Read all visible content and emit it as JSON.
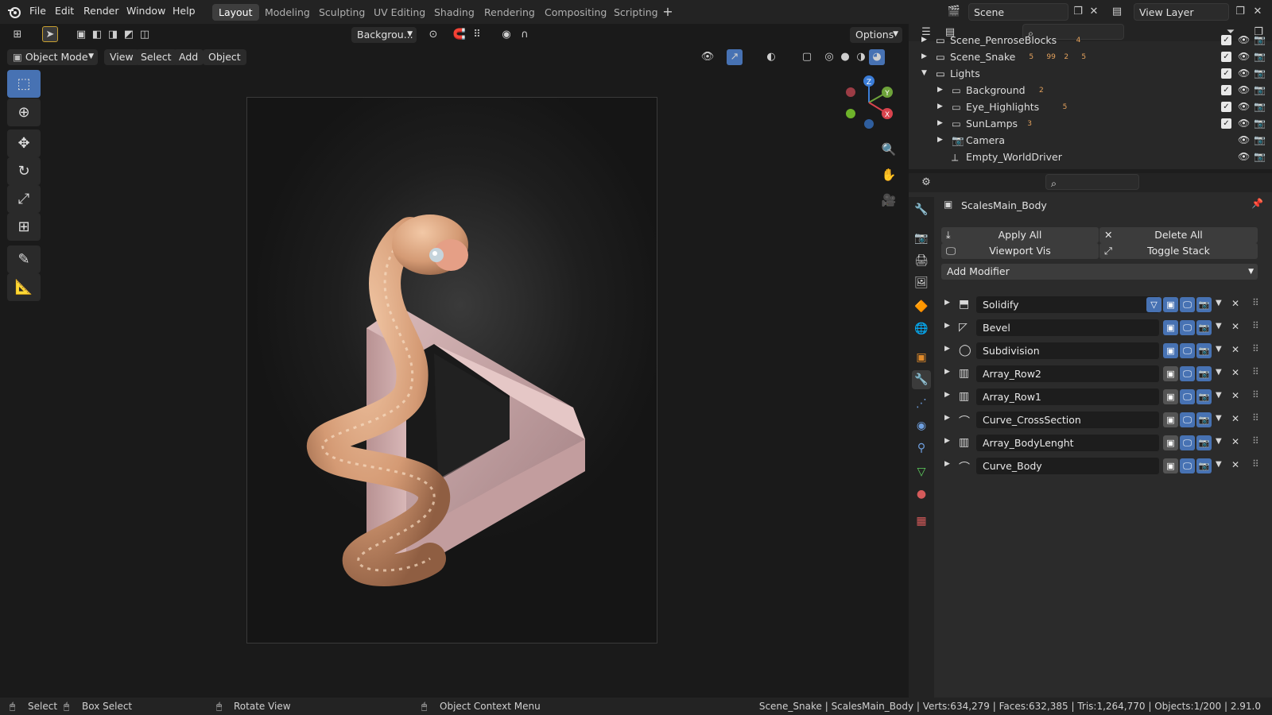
{
  "menu": [
    "File",
    "Edit",
    "Render",
    "Window",
    "Help"
  ],
  "workspaces": [
    "Layout",
    "Modeling",
    "Sculpting",
    "UV Editing",
    "Shading",
    "Rendering",
    "Compositing",
    "Scripting"
  ],
  "active_workspace": "Layout",
  "scene_field": "Scene",
  "view_layer_field": "View Layer",
  "viewport": {
    "mode": "Object Mode",
    "menus": [
      "View",
      "Select",
      "Add",
      "Object"
    ],
    "background_dropdown": "Backgrou...",
    "options_label": "Options",
    "gizmo_axes": [
      "X",
      "Y",
      "Z"
    ]
  },
  "outliner": {
    "rows": [
      {
        "label": "Scene_PenroseBlocks",
        "indent": 0,
        "count_badges": [
          "4"
        ]
      },
      {
        "label": "Scene_Snake",
        "indent": 0,
        "count_badges": [
          "5",
          "99",
          "2",
          "5"
        ]
      },
      {
        "label": "Lights",
        "indent": 0,
        "expanded": true,
        "count_badges": []
      },
      {
        "label": "Background",
        "indent": 1,
        "count_badges": [
          "2"
        ]
      },
      {
        "label": "Eye_Highlights",
        "indent": 1,
        "count_badges": [
          "5"
        ]
      },
      {
        "label": "SunLamps",
        "indent": 1,
        "count_badges": [
          "3"
        ]
      },
      {
        "label": "Camera",
        "indent": 1,
        "count_badges": []
      },
      {
        "label": "Empty_WorldDriver",
        "indent": 1,
        "count_badges": []
      }
    ]
  },
  "properties": {
    "object_name": "ScalesMain_Body",
    "apply_all": "Apply All",
    "delete_all": "Delete All",
    "viewport_vis": "Viewport Vis",
    "toggle_stack": "Toggle Stack",
    "add_modifier": "Add Modifier",
    "modifiers": [
      {
        "name": "Solidify",
        "icon": "solidify-icon"
      },
      {
        "name": "Bevel",
        "icon": "bevel-icon"
      },
      {
        "name": "Subdivision",
        "icon": "subdivision-icon"
      },
      {
        "name": "Array_Row2",
        "icon": "array-icon"
      },
      {
        "name": "Array_Row1",
        "icon": "array-icon"
      },
      {
        "name": "Curve_CrossSection",
        "icon": "curve-icon"
      },
      {
        "name": "Array_BodyLenght",
        "icon": "array-icon"
      },
      {
        "name": "Curve_Body",
        "icon": "curve-icon"
      }
    ]
  },
  "status": {
    "select": "Select",
    "box_select": "Box Select",
    "rotate_view": "Rotate View",
    "context_menu": "Object Context Menu",
    "stats": "Scene_Snake | ScalesMain_Body | Verts:634,279 | Faces:632,385 | Tris:1,264,770 | Objects:1/200 | 2.91.0"
  },
  "colors": {
    "accent": "#4772b3",
    "panel": "#2b2b2b",
    "header": "#232323",
    "sculpt_pink": "#c9a3a5",
    "scales": "#d9a07e"
  }
}
